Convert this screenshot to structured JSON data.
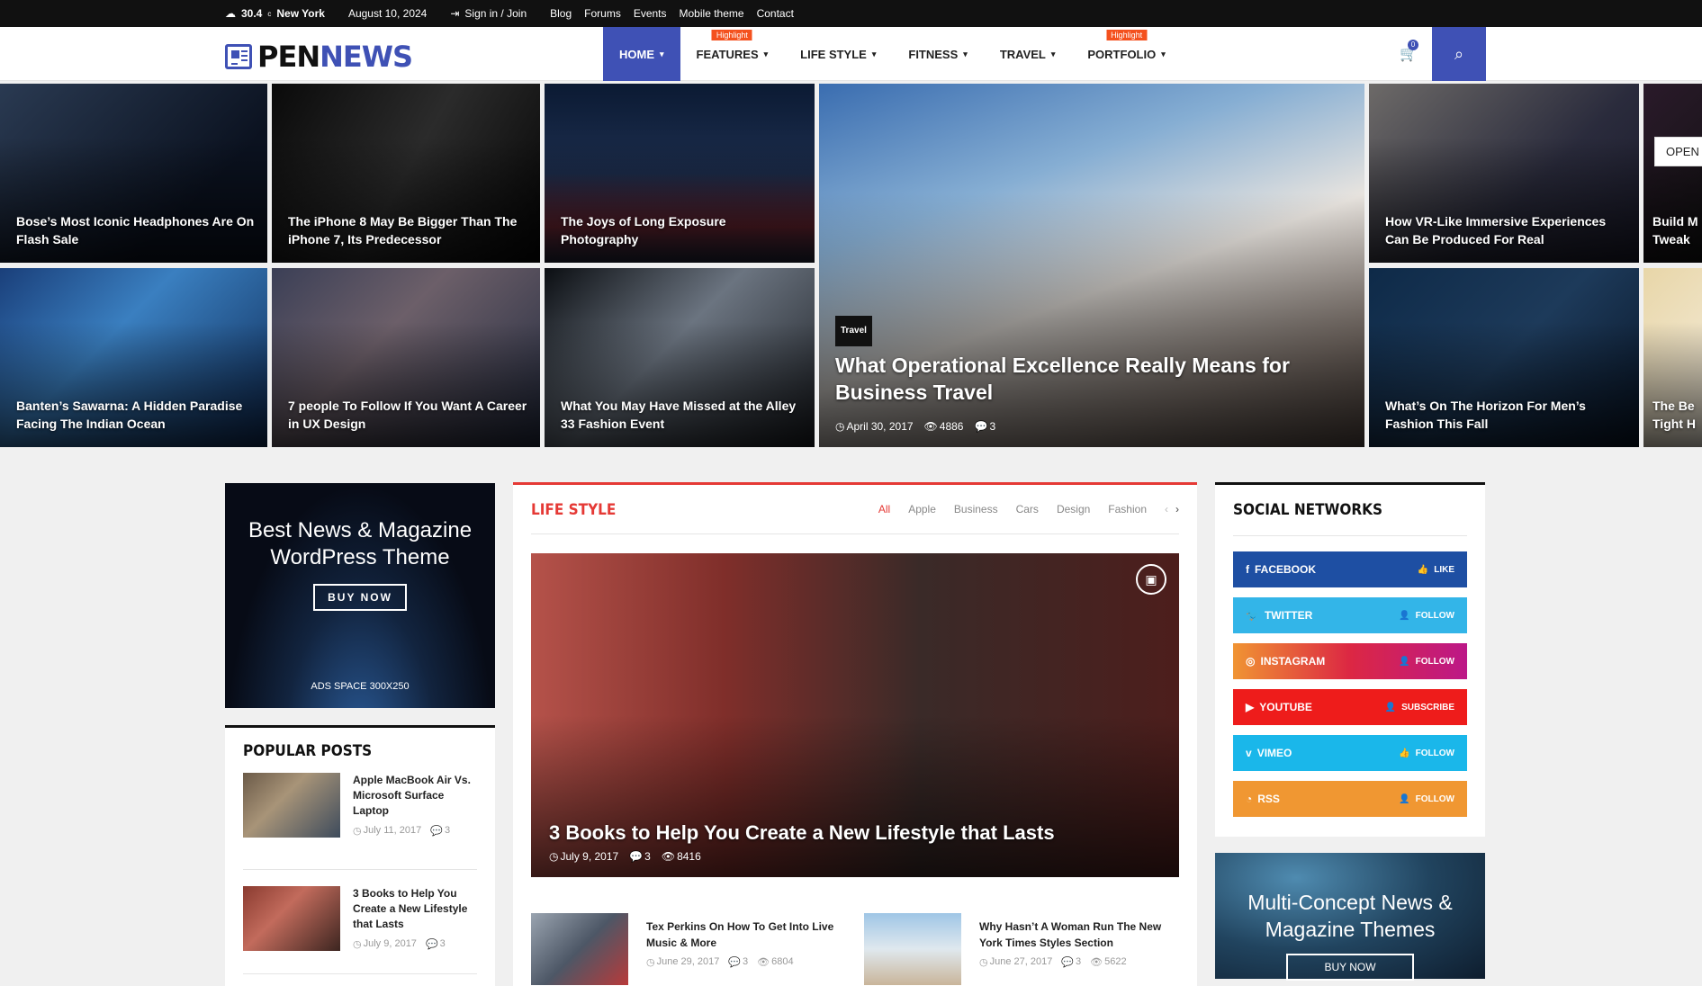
{
  "topbar": {
    "temp": "30.4",
    "temp_unit": "c",
    "city": "New York",
    "date": "August 10, 2024",
    "signin": "Sign in / Join",
    "links": [
      "Blog",
      "Forums",
      "Events",
      "Mobile theme",
      "Contact"
    ],
    "social": [
      "f",
      "t",
      "ig",
      "p",
      "G+",
      "yt"
    ]
  },
  "logo": {
    "part1": "PEN",
    "part2": "NEWS"
  },
  "nav": [
    {
      "label": "HOME",
      "active": true,
      "highlight": ""
    },
    {
      "label": "FEATURES",
      "active": false,
      "highlight": "Highlight"
    },
    {
      "label": "LIFE STYLE",
      "active": false,
      "highlight": ""
    },
    {
      "label": "FITNESS",
      "active": false,
      "highlight": ""
    },
    {
      "label": "TRAVEL",
      "active": false,
      "highlight": ""
    },
    {
      "label": "PORTFOLIO",
      "active": false,
      "highlight": "Highlight"
    }
  ],
  "cart_count": "0",
  "tiles": [
    {
      "title": "Bose’s Most Iconic Headphones Are On Flash Sale"
    },
    {
      "title": "The iPhone 8 May Be Bigger Than The iPhone 7, Its Predecessor"
    },
    {
      "title": "The Joys of Long Exposure Photography"
    },
    {
      "title": "How VR-Like Immersive Experiences Can Be Produced For Real"
    },
    {
      "title": "Build M Tweak"
    },
    {
      "title": "Banten’s Sawarna: A Hidden Paradise Facing The Indian Ocean"
    },
    {
      "title": "7 people To Follow If You Want A Career in UX Design"
    },
    {
      "title": "What You May Have Missed at the Alley 33 Fashion Event"
    },
    {
      "title": "What’s On The Horizon For Men’s Fashion This Fall"
    },
    {
      "title": "The Be Tight H"
    }
  ],
  "big_tile": {
    "category": "Travel",
    "title": "What Operational Excellence Really Means for Business Travel",
    "date": "April 30, 2017",
    "views": "4886",
    "comments": "3"
  },
  "open_label": "OPEN",
  "ad": {
    "title": "Best News & Magazine WordPress Theme",
    "button": "BUY NOW",
    "space": "ADS SPACE 300X250"
  },
  "popular": {
    "heading": "POPULAR POSTS",
    "items": [
      {
        "title": "Apple MacBook Air Vs. Microsoft Surface Laptop",
        "date": "July 11, 2017",
        "comments": "3"
      },
      {
        "title": "3 Books to Help You Create a New Lifestyle that Lasts",
        "date": "July 9, 2017",
        "comments": "3"
      }
    ]
  },
  "lifestyle": {
    "heading": "LIFE STYLE",
    "tabs": [
      "All",
      "Apple",
      "Business",
      "Cars",
      "Design",
      "Fashion"
    ],
    "featured": {
      "title": "3 Books to Help You Create a New Lifestyle that Lasts",
      "date": "July 9, 2017",
      "comments": "3",
      "views": "8416"
    },
    "subs": [
      {
        "title": "Tex Perkins On How To Get Into Live Music & More",
        "date": "June 29, 2017",
        "comments": "3",
        "views": "6804"
      },
      {
        "title": "Why Hasn’t A Woman Run The New York Times Styles Section",
        "date": "June 27, 2017",
        "comments": "3",
        "views": "5622"
      }
    ]
  },
  "social": {
    "heading": "SOCIAL NETWORKS",
    "items": [
      {
        "name": "FACEBOOK",
        "action": "LIKE",
        "color": "#1e4fa3"
      },
      {
        "name": "TWITTER",
        "action": "FOLLOW",
        "color": "#33b5e8"
      },
      {
        "name": "INSTAGRAM",
        "action": "FOLLOW",
        "color": "#b04eaa"
      },
      {
        "name": "YOUTUBE",
        "action": "SUBSCRIBE",
        "color": "#ee1c1b"
      },
      {
        "name": "VIMEO",
        "action": "FOLLOW",
        "color": "#1ab7ea"
      },
      {
        "name": "RSS",
        "action": "FOLLOW",
        "color": "#f09732"
      }
    ]
  },
  "multi": {
    "title": "Multi-Concept News & Magazine Themes",
    "button": "BUY NOW"
  }
}
